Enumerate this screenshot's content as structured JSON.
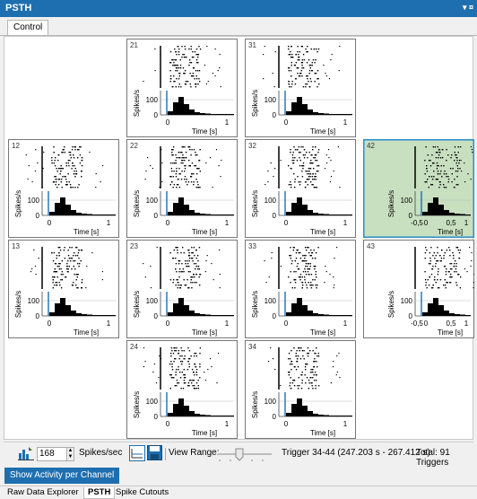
{
  "window": {
    "title": "PSTH",
    "menu_glyph": "▾ ¤"
  },
  "tabs_top": [
    {
      "label": "Control"
    }
  ],
  "plot": {
    "y_axis_label": "Spikes/s",
    "x_axis_label": "Time [s]",
    "y_tick_100": "100",
    "y_tick_0": "0"
  },
  "cells": [
    {
      "id": "21",
      "row": 0,
      "col": 1,
      "xticks": [
        "0",
        "1"
      ],
      "wide": false,
      "selected": false
    },
    {
      "id": "31",
      "row": 0,
      "col": 2,
      "xticks": [
        "0",
        "1"
      ],
      "wide": false,
      "selected": false
    },
    {
      "id": "12",
      "row": 1,
      "col": 0,
      "xticks": [
        "0",
        "1"
      ],
      "wide": false,
      "selected": false
    },
    {
      "id": "22",
      "row": 1,
      "col": 1,
      "xticks": [
        "0",
        "1"
      ],
      "wide": false,
      "selected": false
    },
    {
      "id": "32",
      "row": 1,
      "col": 2,
      "xticks": [
        "0",
        "1"
      ],
      "wide": false,
      "selected": false
    },
    {
      "id": "42",
      "row": 1,
      "col": 3,
      "xticks": [
        "-0,5",
        "0",
        "0,5",
        "1"
      ],
      "wide": true,
      "selected": true
    },
    {
      "id": "13",
      "row": 2,
      "col": 0,
      "xticks": [
        "0",
        "1"
      ],
      "wide": false,
      "selected": false
    },
    {
      "id": "23",
      "row": 2,
      "col": 1,
      "xticks": [
        "0",
        "1"
      ],
      "wide": false,
      "selected": false
    },
    {
      "id": "33",
      "row": 2,
      "col": 2,
      "xticks": [
        "0",
        "1"
      ],
      "wide": false,
      "selected": false
    },
    {
      "id": "43",
      "row": 2,
      "col": 3,
      "xticks": [
        "-0,5",
        "0",
        "0,5",
        "1"
      ],
      "wide": true,
      "selected": false
    },
    {
      "id": "24",
      "row": 3,
      "col": 1,
      "xticks": [
        "0",
        "1"
      ],
      "wide": false,
      "selected": false
    },
    {
      "id": "34",
      "row": 3,
      "col": 2,
      "xticks": [
        "0",
        "1"
      ],
      "wide": false,
      "selected": false
    }
  ],
  "toolbar": {
    "spin_value": "168",
    "unit_label": "Spikes/sec",
    "view_range_label": "View Range:",
    "trigger_info": "Trigger 34-44 (247.203 s - 267.412 s)",
    "total_info": "Total: 91 Triggers",
    "icons": [
      "bar-chart-icon",
      "graph-icon",
      "save-icon"
    ]
  },
  "show_button": {
    "label": "Show Activity per Channel"
  },
  "bottom_tabs": [
    {
      "label": "Raw Data Explorer",
      "active": false
    },
    {
      "label": "PSTH",
      "active": true
    },
    {
      "label": "Spike Cutouts",
      "active": false
    }
  ],
  "colors": {
    "accent": "#1e6fb0",
    "selected_bg": "#c8dfc0",
    "selected_border": "#2a8fd0"
  }
}
